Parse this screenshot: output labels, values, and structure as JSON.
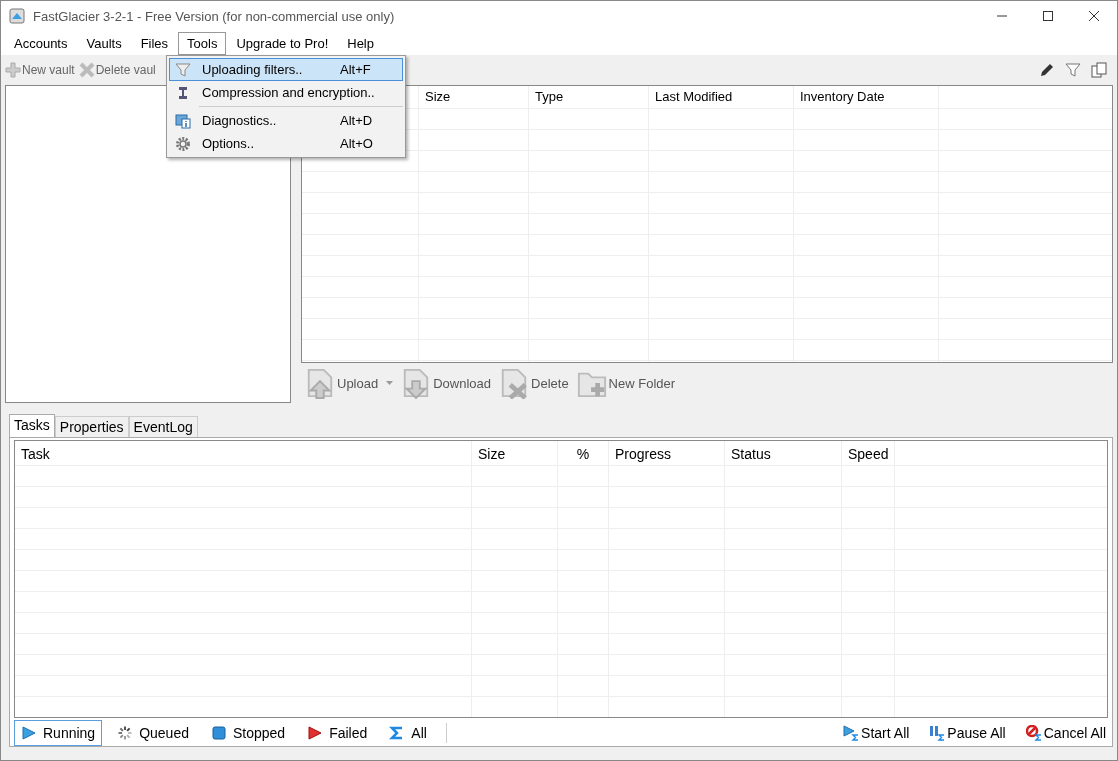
{
  "window": {
    "title": "FastGlacier 3-2-1 - Free Version (for non-commercial use only)"
  },
  "menu_bar": [
    {
      "label": "Accounts",
      "selected": false
    },
    {
      "label": "Vaults",
      "selected": false
    },
    {
      "label": "Files",
      "selected": false
    },
    {
      "label": "Tools",
      "selected": true
    },
    {
      "label": "Upgrade to Pro!",
      "selected": false
    },
    {
      "label": "Help",
      "selected": false
    }
  ],
  "tools_menu": [
    {
      "label": "Uploading filters..",
      "shortcut": "Alt+F",
      "selected": true,
      "separator_after": false
    },
    {
      "label": "Compression and encryption..",
      "selected": false,
      "separator_after": true
    },
    {
      "label": "Diagnostics..",
      "shortcut": "Alt+D",
      "selected": false,
      "separator_after": false
    },
    {
      "label": "Options..",
      "shortcut": "Alt+O",
      "selected": false,
      "separator_after": false
    }
  ],
  "vault_toolbar": [
    {
      "label": "New vault",
      "disabled": true
    },
    {
      "label": "Delete vaul",
      "disabled": true
    }
  ],
  "file_table": {
    "columns": [
      "",
      "Size",
      "Type",
      "Last Modified",
      "Inventory Date"
    ]
  },
  "file_actions": [
    {
      "label": "Upload",
      "disabled": true,
      "dropdown": true
    },
    {
      "label": "Download",
      "disabled": true,
      "dropdown": false
    },
    {
      "label": "Delete",
      "disabled": true,
      "dropdown": false
    },
    {
      "label": "New Folder",
      "disabled": true,
      "dropdown": false
    }
  ],
  "tabs": [
    {
      "label": "Tasks",
      "selected": true
    },
    {
      "label": "Properties",
      "selected": false
    },
    {
      "label": "EventLog",
      "selected": false
    }
  ],
  "task_table": {
    "columns": [
      "Task",
      "Size",
      "%",
      "Progress",
      "Status",
      "Speed"
    ]
  },
  "task_filters": [
    {
      "label": "Running",
      "selected": true
    },
    {
      "label": "Queued",
      "selected": false
    },
    {
      "label": "Stopped",
      "selected": false
    },
    {
      "label": "Failed",
      "selected": false
    },
    {
      "label": "All",
      "selected": false
    }
  ],
  "task_actions": [
    {
      "label": "Start All"
    },
    {
      "label": "Pause All"
    },
    {
      "label": "Cancel All"
    }
  ]
}
